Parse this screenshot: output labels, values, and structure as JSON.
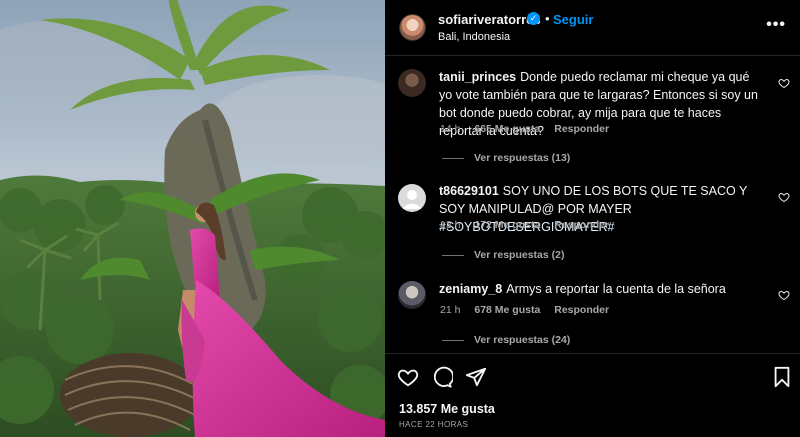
{
  "post": {
    "author": "sofiariveratorres",
    "verified_badge": "verified-icon",
    "separator": "•",
    "follow_label": "Seguir",
    "location": "Bali, Indonesia",
    "more_label": "•••"
  },
  "comments": [
    {
      "user": "tanii_princes",
      "text": "Donde puedo reclamar mi cheque ya qué yo vote también para que te largaras? Entonces si soy un bot donde puedo cobrar, ay mija para que te haces reportar la cuenta?",
      "time": "14 h",
      "likes": "665 Me gusta",
      "reply": "Responder",
      "replies": "Ver respuestas (13)"
    },
    {
      "user": "t86629101",
      "text_before": "SOY UNO DE LOS BOTS QUE TE SACO Y SOY MANIPULAD@ POR MAYER ",
      "hashtag": "#SOYBOTDESERGIOMAYER#",
      "time": "13 h",
      "likes": "172 Me gusta",
      "reply": "Responder",
      "replies": "Ver respuestas (2)"
    },
    {
      "user": "zeniamy_8",
      "text": "Armys a reportar la cuenta de la señora",
      "time": "21 h",
      "likes": "678 Me gusta",
      "reply": "Responder",
      "replies": "Ver respuestas (24)"
    }
  ],
  "footer": {
    "likes_total": "13.857 Me gusta",
    "time_ago": "HACE 22 HORAS"
  },
  "colors": {
    "accent": "#0095f6",
    "background": "#000000",
    "dress": "#d7339a"
  }
}
